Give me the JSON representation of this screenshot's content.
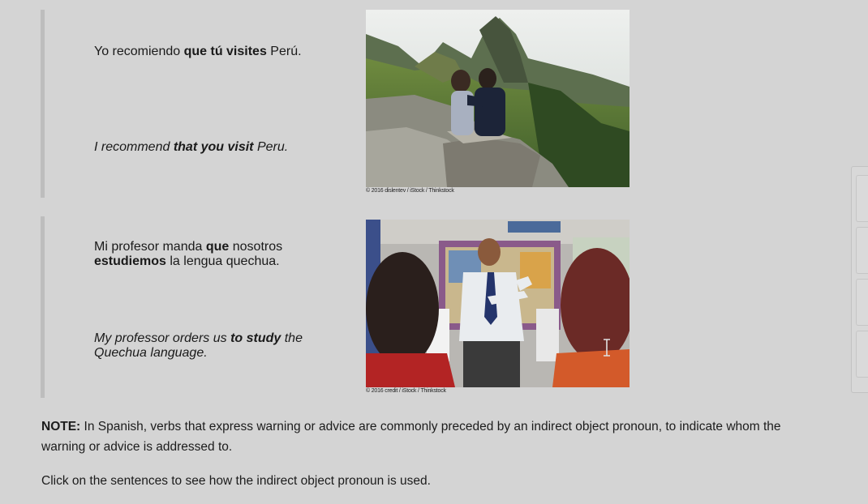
{
  "examples": [
    {
      "es_parts": [
        "Yo recomiendo ",
        "que tú visites",
        " Perú."
      ],
      "en_parts": [
        "I recommend ",
        "that you visit",
        " Peru."
      ],
      "photo_alt": "Couple sitting on a rock overlooking Machu Picchu",
      "credit": "© 2016 dislentev / iStock / Thinkstock"
    },
    {
      "es_parts": [
        "Mi profesor manda ",
        "que",
        " nosotros ",
        "estudiemos",
        " la lengua quechua."
      ],
      "en_parts": [
        "My professor orders us ",
        "to study",
        " the Quechua language."
      ],
      "photo_alt": "Teacher gesturing in front of a classroom",
      "credit": "© 2016 credit / iStock / Thinkstock"
    }
  ],
  "note": {
    "label": "NOTE:",
    "text": " In Spanish, verbs that express warning or advice are commonly preceded by an indirect object pronoun, to indicate whom the warning or advice is addressed to."
  },
  "instruction": "Click on the sentences to see how the indirect object pronoun is used.",
  "colors": {
    "background": "#d4d4d4",
    "rule": "#bdbdbd",
    "text": "#1c1c1c"
  }
}
